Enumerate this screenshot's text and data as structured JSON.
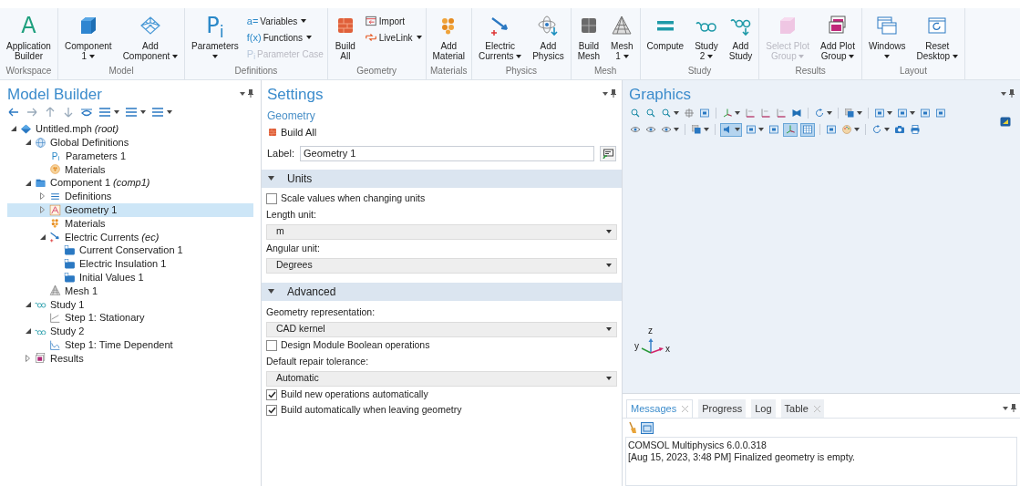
{
  "ribbon": {
    "groups": [
      {
        "label": "Workspace",
        "buttons": [
          {
            "kind": "letter",
            "glyph": "A",
            "lines": [
              "Application",
              "Builder"
            ],
            "dropdown": false,
            "disabled": false
          }
        ]
      },
      {
        "label": "Model",
        "buttons": [
          {
            "kind": "cube",
            "lines": [
              "Component",
              "1"
            ],
            "dropdown": true,
            "disabled": false
          },
          {
            "kind": "wire",
            "lines": [
              "Add",
              "Component"
            ],
            "dropdown": true,
            "disabled": false
          }
        ]
      },
      {
        "label": "Definitions",
        "buttons": [
          {
            "kind": "letter",
            "glyph": "P$_{i}$",
            "lines": [
              "Parameters"
            ],
            "dropdown": true,
            "disabled": false
          },
          {
            "kind": "stack",
            "items": [
              {
                "kind": "glyph",
                "glyph": "a=",
                "label": "Variables",
                "dropdown": true,
                "disabled": false
              },
              {
                "kind": "glyph",
                "glyph": "f(x)",
                "label": "Functions",
                "dropdown": true,
                "disabled": false
              },
              {
                "kind": "glyph",
                "glyph": "P$_{i}$",
                "label": "Parameter Case",
                "dropdown": false,
                "disabled": true
              }
            ]
          }
        ]
      },
      {
        "label": "Geometry",
        "buttons": [
          {
            "kind": "bricks",
            "lines": [
              "Build",
              "All"
            ],
            "dropdown": false,
            "disabled": false
          },
          {
            "kind": "stack",
            "items": [
              {
                "kind": "import",
                "label": "Import",
                "dropdown": false,
                "disabled": false
              },
              {
                "kind": "link",
                "label": "LiveLink",
                "dropdown": true,
                "disabled": false
              }
            ]
          }
        ]
      },
      {
        "label": "Materials",
        "buttons": [
          {
            "kind": "material",
            "lines": [
              "Add",
              "Material"
            ],
            "dropdown": false,
            "disabled": false
          }
        ]
      },
      {
        "label": "Physics",
        "buttons": [
          {
            "kind": "electric",
            "lines": [
              "Electric",
              "Currents"
            ],
            "dropdown": true,
            "disabled": false
          },
          {
            "kind": "atom",
            "lines": [
              "Add",
              "Physics"
            ],
            "dropdown": false,
            "disabled": false
          }
        ]
      },
      {
        "label": "Mesh",
        "buttons": [
          {
            "kind": "grid",
            "lines": [
              "Build",
              "Mesh"
            ],
            "dropdown": false,
            "disabled": false
          },
          {
            "kind": "mesh",
            "lines": [
              "Mesh",
              "1"
            ],
            "dropdown": true,
            "disabled": false
          }
        ]
      },
      {
        "label": "Study",
        "buttons": [
          {
            "kind": "equals",
            "lines": [
              "Compute"
            ],
            "dropdown": false,
            "disabled": false
          },
          {
            "kind": "glasses",
            "lines": [
              "Study",
              "2"
            ],
            "dropdown": true,
            "disabled": false
          },
          {
            "kind": "glasses-add",
            "lines": [
              "Add",
              "Study"
            ],
            "dropdown": false,
            "disabled": false
          }
        ]
      },
      {
        "label": "Results",
        "buttons": [
          {
            "kind": "box",
            "lines": [
              "Select Plot",
              "Group"
            ],
            "dropdown": true,
            "disabled": true
          },
          {
            "kind": "plots",
            "lines": [
              "Add Plot",
              "Group"
            ],
            "dropdown": true,
            "disabled": false
          }
        ]
      },
      {
        "label": "Layout",
        "buttons": [
          {
            "kind": "windows",
            "lines": [
              "Windows"
            ],
            "dropdown": true,
            "disabled": false
          },
          {
            "kind": "reset",
            "lines": [
              "Reset",
              "Desktop"
            ],
            "dropdown": true,
            "disabled": false
          }
        ]
      }
    ]
  },
  "model_builder": {
    "title": "Model Builder",
    "tree": [
      {
        "label": "Untitled.mph *(root)*",
        "kind": "root",
        "expanded": true,
        "selected": false,
        "children": [
          {
            "label": "Global Definitions",
            "kind": "globe",
            "expanded": true,
            "selected": false,
            "children": [
              {
                "label": "Parameters 1",
                "kind": "glyph",
                "glyph": "P$_{i}$",
                "selected": false
              },
              {
                "label": "Materials",
                "kind": "material-round",
                "selected": false
              }
            ]
          },
          {
            "label": "Component 1 *(comp1)*",
            "kind": "component",
            "expanded": true,
            "selected": false,
            "children": [
              {
                "label": "Definitions",
                "kind": "definitions",
                "expanded": false,
                "selected": false
              },
              {
                "label": "Geometry 1",
                "kind": "geometry",
                "expanded": false,
                "selected": true
              },
              {
                "label": "Materials",
                "kind": "material",
                "selected": false
              },
              {
                "label": "Electric Currents *(ec)*",
                "kind": "electric",
                "expanded": true,
                "selected": false,
                "children": [
                  {
                    "label": "Current Conservation 1",
                    "kind": "feature",
                    "selected": false
                  },
                  {
                    "label": "Electric Insulation 1",
                    "kind": "feature",
                    "selected": false
                  },
                  {
                    "label": "Initial Values 1",
                    "kind": "feature",
                    "selected": false
                  }
                ]
              },
              {
                "label": "Mesh 1",
                "kind": "mesh",
                "selected": false
              }
            ]
          },
          {
            "label": "Study 1",
            "kind": "glasses",
            "expanded": true,
            "selected": false,
            "children": [
              {
                "label": "Step 1: Stationary",
                "kind": "stationary",
                "selected": false
              }
            ]
          },
          {
            "label": "Study 2",
            "kind": "glasses",
            "expanded": true,
            "selected": false,
            "children": [
              {
                "label": "Step 1: Time Dependent",
                "kind": "timedep",
                "selected": false
              }
            ]
          },
          {
            "label": "Results",
            "kind": "results",
            "expanded": false,
            "selected": false
          }
        ]
      }
    ]
  },
  "settings": {
    "title": "Settings",
    "subtitle": "Geometry",
    "build_button": "Build All",
    "label_caption": "Label:",
    "label_value": "Geometry 1",
    "sections": [
      {
        "title": "Units",
        "expanded": true,
        "items": [
          {
            "kind": "checkbox",
            "label": "Scale values when changing units",
            "checked": false
          },
          {
            "kind": "caption",
            "text": "Length unit:"
          },
          {
            "kind": "select",
            "value": "m"
          },
          {
            "kind": "caption",
            "text": "Angular unit:"
          },
          {
            "kind": "select",
            "value": "Degrees"
          }
        ]
      },
      {
        "title": "Advanced",
        "expanded": true,
        "items": [
          {
            "kind": "caption",
            "text": "Geometry representation:"
          },
          {
            "kind": "select",
            "value": "CAD kernel"
          },
          {
            "kind": "checkbox",
            "label": "Design Module Boolean operations",
            "checked": false
          },
          {
            "kind": "caption",
            "text": "Default repair tolerance:"
          },
          {
            "kind": "select",
            "value": "Automatic"
          },
          {
            "kind": "checkbox",
            "label": "Build new operations automatically",
            "checked": true
          },
          {
            "kind": "checkbox",
            "label": "Build automatically when leaving geometry",
            "checked": true
          }
        ]
      }
    ]
  },
  "graphics": {
    "title": "Graphics",
    "toolbar": [
      [
        {
          "kind": "zoom",
          "dropdown": false,
          "selected": false
        },
        {
          "kind": "zoom",
          "dropdown": false,
          "selected": false
        },
        {
          "kind": "zoom",
          "dropdown": true,
          "selected": false
        },
        {
          "kind": "target",
          "dropdown": false,
          "selected": false
        },
        {
          "kind": "frame",
          "dropdown": false,
          "selected": false
        },
        {
          "kind": "sep"
        },
        {
          "kind": "axes",
          "dropdown": true,
          "selected": false
        },
        {
          "kind": "plane",
          "dropdown": false,
          "selected": false
        },
        {
          "kind": "plane",
          "dropdown": false,
          "selected": false
        },
        {
          "kind": "plane",
          "dropdown": false,
          "selected": false
        },
        {
          "kind": "bowtie",
          "dropdown": false,
          "selected": false
        },
        {
          "kind": "sep"
        },
        {
          "kind": "rotate",
          "dropdown": true,
          "selected": false
        },
        {
          "kind": "sep"
        },
        {
          "kind": "layers",
          "dropdown": true,
          "selected": false
        },
        {
          "kind": "sep"
        },
        {
          "kind": "frame",
          "dropdown": true,
          "selected": false
        },
        {
          "kind": "frame",
          "dropdown": true,
          "selected": false
        },
        {
          "kind": "frame",
          "dropdown": false,
          "selected": false
        },
        {
          "kind": "frame",
          "dropdown": false,
          "selected": false
        }
      ],
      [
        {
          "kind": "eye",
          "dropdown": false,
          "selected": false
        },
        {
          "kind": "eye",
          "dropdown": false,
          "selected": false
        },
        {
          "kind": "eye",
          "dropdown": true,
          "selected": false
        },
        {
          "kind": "sep"
        },
        {
          "kind": "layers",
          "dropdown": true,
          "selected": false
        },
        {
          "kind": "sep"
        },
        {
          "kind": "speaker",
          "dropdown": true,
          "selected": true
        },
        {
          "kind": "frame",
          "dropdown": true,
          "selected": false
        },
        {
          "kind": "frame",
          "dropdown": false,
          "selected": false
        },
        {
          "kind": "axes",
          "dropdown": false,
          "selected": true
        },
        {
          "kind": "table",
          "dropdown": false,
          "selected": true
        },
        {
          "kind": "sep"
        },
        {
          "kind": "frame",
          "dropdown": false,
          "selected": false
        },
        {
          "kind": "palette",
          "dropdown": true,
          "selected": false
        },
        {
          "kind": "sep"
        },
        {
          "kind": "rotate",
          "dropdown": true,
          "selected": false
        },
        {
          "kind": "camera",
          "dropdown": false,
          "selected": false
        },
        {
          "kind": "printer",
          "dropdown": false,
          "selected": false
        }
      ]
    ],
    "axes": {
      "z": "z",
      "y": "y",
      "x": "x"
    }
  },
  "messages": {
    "tabs": [
      {
        "label": "Messages",
        "selected": true,
        "closable": true
      },
      {
        "label": "Progress",
        "selected": false,
        "closable": false
      },
      {
        "label": "Log",
        "selected": false,
        "closable": false
      },
      {
        "label": "Table",
        "selected": false,
        "closable": true
      }
    ],
    "lines": [
      "COMSOL Multiphysics 6.0.0.318",
      "[Aug 15, 2023, 3:48 PM] Finalized geometry is empty."
    ]
  }
}
